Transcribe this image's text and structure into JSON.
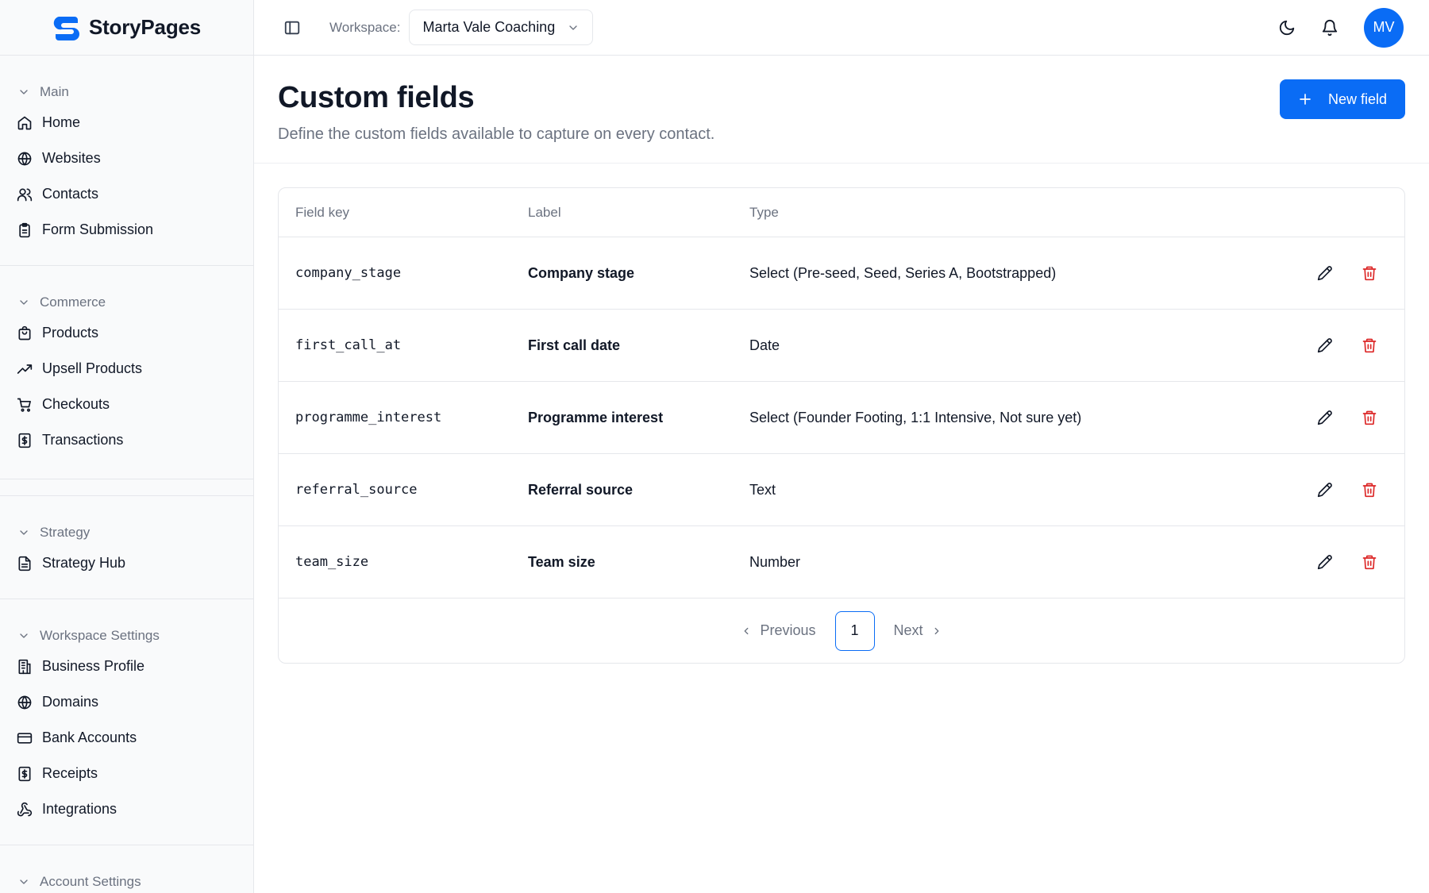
{
  "brand": {
    "name": "StoryPages",
    "logo_color": "#0a6cf5"
  },
  "topbar": {
    "workspace_label": "Workspace:",
    "workspace_value": "Marta Vale Coaching",
    "avatar_initials": "MV"
  },
  "sidebar": {
    "sections": [
      {
        "title": "Main",
        "items": [
          "Home",
          "Websites",
          "Contacts",
          "Form Submission"
        ]
      },
      {
        "title": "Commerce",
        "items": [
          "Products",
          "Upsell Products",
          "Checkouts",
          "Transactions"
        ]
      },
      {
        "title": "Strategy",
        "items": [
          "Strategy Hub"
        ]
      },
      {
        "title": "Workspace Settings",
        "items": [
          "Business Profile",
          "Domains",
          "Bank Accounts",
          "Receipts",
          "Integrations"
        ]
      },
      {
        "title": "Account Settings",
        "items": []
      }
    ]
  },
  "page": {
    "title": "Custom fields",
    "subtitle": "Define the custom fields available to capture on every contact.",
    "new_button": "New field"
  },
  "table": {
    "headers": {
      "key": "Field key",
      "label": "Label",
      "type": "Type"
    },
    "rows": [
      {
        "key": "company_stage",
        "label": "Company stage",
        "type": "Select (Pre-seed, Seed, Series A, Bootstrapped)"
      },
      {
        "key": "first_call_at",
        "label": "First call date",
        "type": "Date"
      },
      {
        "key": "programme_interest",
        "label": "Programme interest",
        "type": "Select (Founder Footing, 1:1 Intensive, Not sure yet)"
      },
      {
        "key": "referral_source",
        "label": "Referral source",
        "type": "Text"
      },
      {
        "key": "team_size",
        "label": "Team size",
        "type": "Number"
      }
    ]
  },
  "pagination": {
    "previous": "Previous",
    "current": "1",
    "next": "Next"
  },
  "colors": {
    "accent": "#0a6cf5",
    "danger": "#dc2626"
  }
}
